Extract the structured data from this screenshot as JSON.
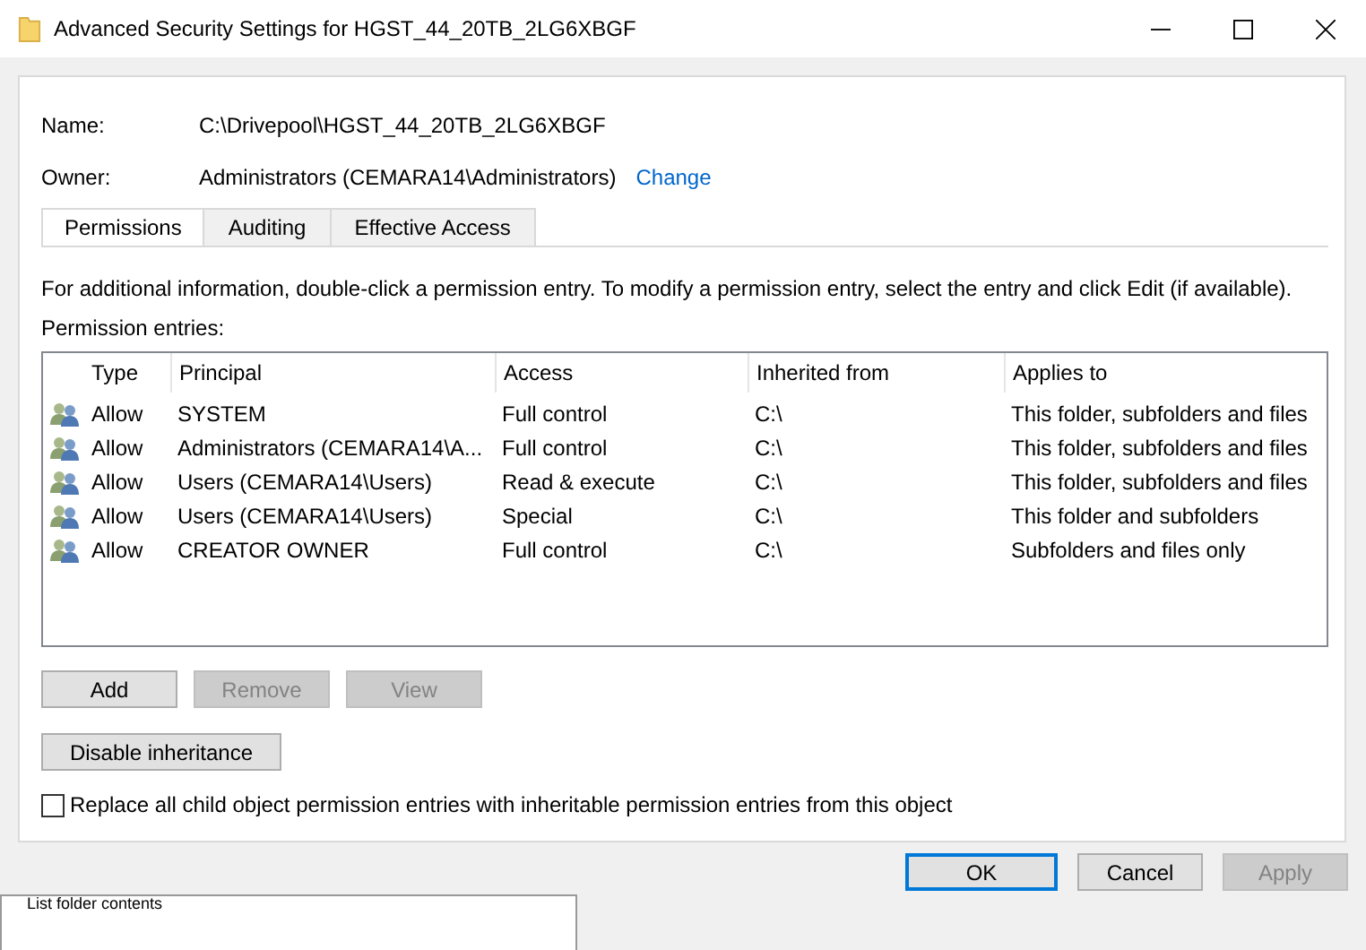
{
  "window": {
    "title": "Advanced Security Settings for HGST_44_20TB_2LG6XBGF"
  },
  "fields": [
    {
      "label": "Name:",
      "value": "C:\\Drivepool\\HGST_44_20TB_2LG6XBGF"
    },
    {
      "label": "Owner:",
      "value": "Administrators (CEMARA14\\Administrators)",
      "link": "Change"
    }
  ],
  "tabs": [
    {
      "label": "Permissions",
      "selected": true
    },
    {
      "label": "Auditing",
      "selected": false
    },
    {
      "label": "Effective Access",
      "selected": false
    }
  ],
  "info_text": "For additional information, double-click a permission entry. To modify a permission entry, select the entry and click Edit (if available).",
  "list_label": "Permission entries:",
  "table": {
    "columns": [
      "Type",
      "Principal",
      "Access",
      "Inherited from",
      "Applies to"
    ],
    "rows": [
      {
        "cells": [
          "Allow",
          "SYSTEM",
          "Full control",
          "C:\\",
          "This folder, subfolders and files"
        ]
      },
      {
        "cells": [
          "Allow",
          "Administrators (CEMARA14\\A...",
          "Full control",
          "C:\\",
          "This folder, subfolders and files"
        ]
      },
      {
        "cells": [
          "Allow",
          "Users (CEMARA14\\Users)",
          "Read & execute",
          "C:\\",
          "This folder, subfolders and files"
        ]
      },
      {
        "cells": [
          "Allow",
          "Users (CEMARA14\\Users)",
          "Special",
          "C:\\",
          "This folder and subfolders"
        ]
      },
      {
        "cells": [
          "Allow",
          "CREATOR OWNER",
          "Full control",
          "C:\\",
          "Subfolders and files only"
        ]
      }
    ]
  },
  "entry_buttons": [
    {
      "label": "Add",
      "disabled": false
    },
    {
      "label": "Remove",
      "disabled": true
    },
    {
      "label": "View",
      "disabled": true
    }
  ],
  "inheritance_button": {
    "label": "Disable inheritance"
  },
  "replace_checkbox": {
    "label": "Replace all child object permission entries with inheritable permission entries from this object",
    "checked": false
  },
  "dialog_buttons": [
    {
      "label": "OK",
      "disabled": false,
      "default": true
    },
    {
      "label": "Cancel",
      "disabled": false,
      "default": false
    },
    {
      "label": "Apply",
      "disabled": true,
      "default": false
    }
  ],
  "background_window": {
    "text": "List folder contents"
  }
}
